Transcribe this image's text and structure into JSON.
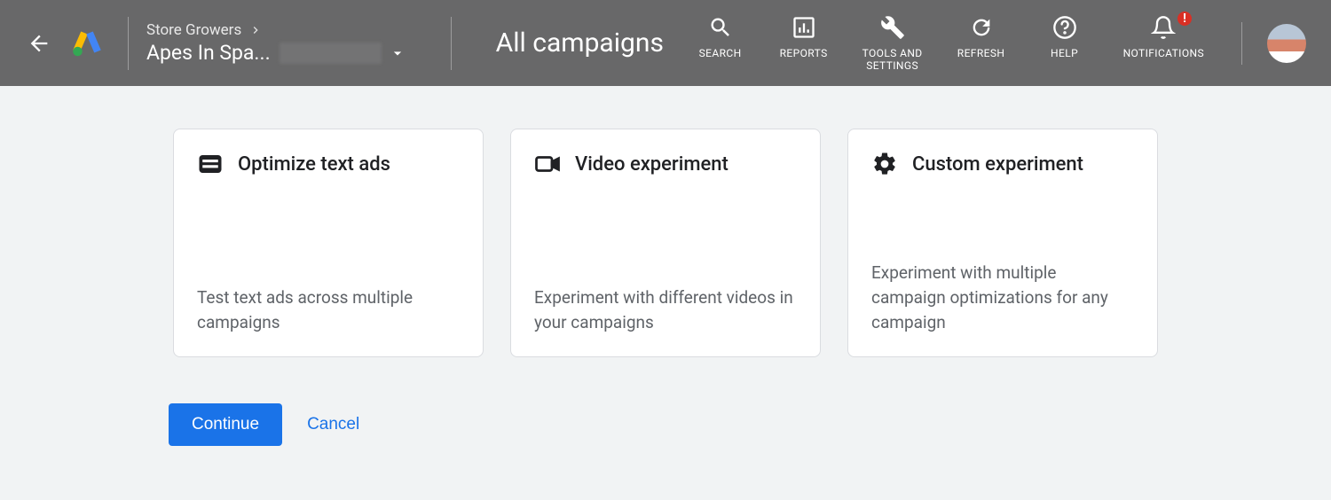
{
  "header": {
    "breadcrumb_parent": "Store Growers",
    "account_name": "Apes In Spa...",
    "page_title": "All campaigns",
    "tools": {
      "search": "SEARCH",
      "reports": "REPORTS",
      "tools": "TOOLS AND\nSETTINGS",
      "refresh": "REFRESH",
      "help": "HELP",
      "notifications": "NOTIFICATIONS"
    },
    "notification_badge": "!"
  },
  "cards": [
    {
      "title": "Optimize text ads",
      "description": "Test text ads across multiple campaigns"
    },
    {
      "title": "Video experiment",
      "description": "Experiment with different videos in your campaigns"
    },
    {
      "title": "Custom experiment",
      "description": "Experiment with multiple campaign optimizations for any campaign"
    }
  ],
  "buttons": {
    "continue": "Continue",
    "cancel": "Cancel"
  }
}
